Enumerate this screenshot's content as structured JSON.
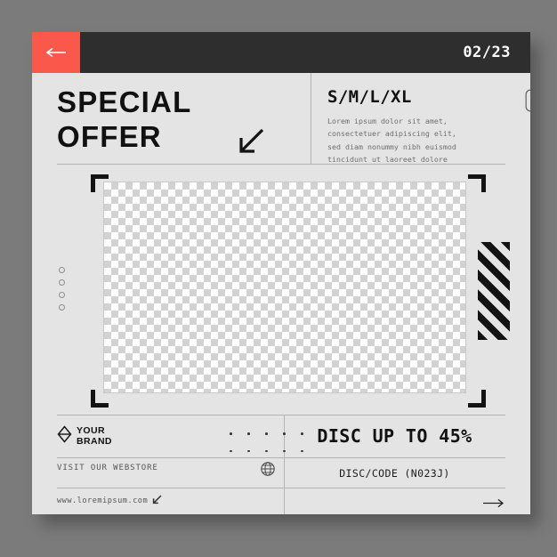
{
  "header": {
    "back_icon": "arrow-left-icon",
    "date_label": "02/23",
    "bar_color": "#2e2e2e",
    "accent_color": "#f9584a"
  },
  "top": {
    "headline": "SPECIAL\nOFFER",
    "headline_arrow_icon": "arrow-down-left-icon",
    "sizes_label": "S/M/L/XL",
    "body_text": "Lorem ipsum dolor sit amet,\nconsectetuer adipiscing elit,\nsed diam nonummy nibh euismod\ntincidunt ut laoreet dolore",
    "pill_icon": "capsule-outline-icon"
  },
  "media": {
    "placeholder_type": "transparent-checkerboard",
    "corner_brackets": 4,
    "dot_column_count": 4,
    "stripes_icon": "diagonal-stripes-decoration"
  },
  "footer": {
    "brand_icon": "diamond-logo-icon",
    "brand_label": "YOUR\nBRAND",
    "dot_grid_columns": 5,
    "dot_grid_rows": 2,
    "webstore_label": "VISIT OUR WEBSTORE",
    "globe_icon": "globe-icon",
    "url_label": "www.loremipsum.com",
    "url_arrow_icon": "arrow-down-left-icon",
    "discount_headline": "DISC UP TO 45%",
    "discount_code": "DISC/CODE (N023J)",
    "next_arrow_icon": "arrow-right-icon"
  },
  "colors": {
    "card_bg": "#e4e4e4",
    "page_bg": "#7b7b7b",
    "ink": "#111111",
    "rule": "#b4b4b4",
    "muted_text": "#6f6f6f"
  }
}
